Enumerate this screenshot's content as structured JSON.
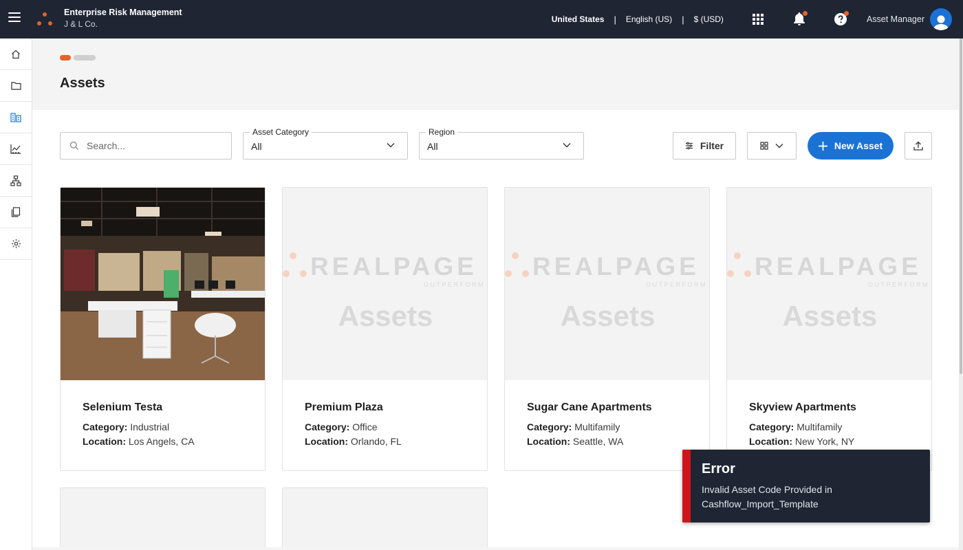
{
  "app": {
    "title": "Enterprise Risk Management",
    "company": "J & L Co.",
    "brand_color": "#e5622a"
  },
  "topbar": {
    "country": "United States",
    "language": "English (US)",
    "currency": "$ (USD)",
    "separator": "|",
    "icons": [
      "apps-grid-icon",
      "notifications-bell-icon",
      "help-icon"
    ],
    "user_role": "Asset Manager"
  },
  "sidebar": {
    "items": [
      {
        "icon": "home-icon"
      },
      {
        "icon": "folder-icon"
      },
      {
        "icon": "assets-icon",
        "active": true
      },
      {
        "icon": "analytics-chart-icon"
      },
      {
        "icon": "hierarchy-icon"
      },
      {
        "icon": "documents-icon"
      },
      {
        "icon": "settings-gear-icon"
      }
    ]
  },
  "page": {
    "title": "Assets"
  },
  "toolbar": {
    "search_placeholder": "Search...",
    "category_label": "Asset Category",
    "category_value": "All",
    "region_label": "Region",
    "region_value": "All",
    "filter_label": "Filter",
    "new_asset_label": "New Asset",
    "accent_color": "#1a73d4"
  },
  "assets": [
    {
      "name": "Selenium Testa",
      "category_label": "Category:",
      "category": "Industrial",
      "location_label": "Location:",
      "location": "Los Angels, CA",
      "has_photo": true
    },
    {
      "name": "Premium Plaza",
      "category_label": "Category:",
      "category": "Office",
      "location_label": "Location:",
      "location": "Orlando, FL",
      "has_photo": false
    },
    {
      "name": "Sugar Cane Apartments",
      "category_label": "Category:",
      "category": "Multifamily",
      "location_label": "Location:",
      "location": "Seattle, WA",
      "has_photo": false
    },
    {
      "name": "Skyview Apartments",
      "category_label": "Category:",
      "category": "Multifamily",
      "location_label": "Location:",
      "location": "New York, NY",
      "has_photo": false
    }
  ],
  "placeholder": {
    "brand_text": "REALPAGE",
    "tagline": "OUTPERFORM",
    "caption": "Assets"
  },
  "toast": {
    "title": "Error",
    "message": "Invalid Asset Code Provided in Cashflow_Import_Template",
    "status_color": "#d0141c"
  }
}
